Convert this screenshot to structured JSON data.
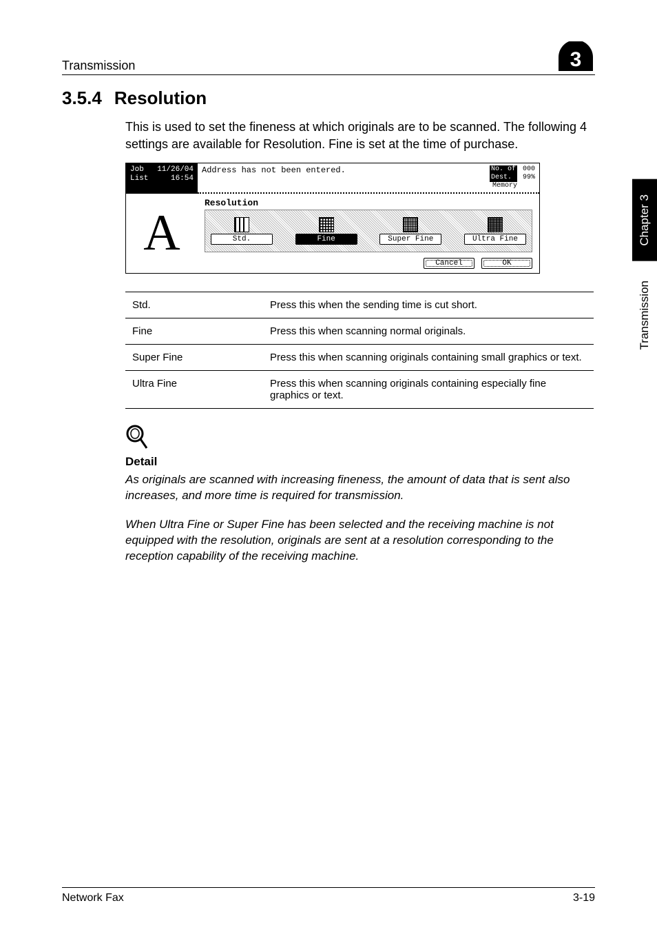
{
  "header": {
    "section": "Transmission"
  },
  "heading": {
    "number": "3.5.4",
    "title": "Resolution"
  },
  "intro": "This is used to set the fineness at which originals are to be scanned. The following 4 settings are available for Resolution. Fine is set at the time of purchase.",
  "lcd": {
    "job_label_1": "Job",
    "job_label_2": "List",
    "job_date": "11/26/04",
    "job_time": "16:54",
    "status_msg": "Address has not been entered.",
    "dest_label": "No. of\nDest.",
    "dest_count": "000",
    "memory_label": "Memory",
    "memory_pct": "99%",
    "panel_title": "Resolution",
    "opts": {
      "std": "Std.",
      "fine": "Fine",
      "sfine": "Super Fine",
      "ufine": "Ultra Fine"
    },
    "cancel": "Cancel",
    "ok": "OK"
  },
  "table": {
    "rows": [
      {
        "k": "Std.",
        "v": "Press this when the sending time is cut short."
      },
      {
        "k": "Fine",
        "v": "Press this when scanning normal originals."
      },
      {
        "k": "Super Fine",
        "v": "Press this when scanning originals containing small graphics or text."
      },
      {
        "k": "Ultra Fine",
        "v": "Press this when scanning originals containing especially fine graphics or text."
      }
    ]
  },
  "detail": {
    "heading": "Detail",
    "p1": "As originals are scanned with increasing fineness, the amount of data that is sent also increases, and more time is required for transmission.",
    "p2": "When Ultra Fine or Super Fine has been selected and the receiving machine is not equipped with the resolution, originals are sent at a resolution corresponding to the reception capability of the receiving machine."
  },
  "side": {
    "chapter": "Chapter 3",
    "section": "Transmission"
  },
  "footer": {
    "left": "Network Fax",
    "right": "3-19"
  },
  "badge_number": "3"
}
